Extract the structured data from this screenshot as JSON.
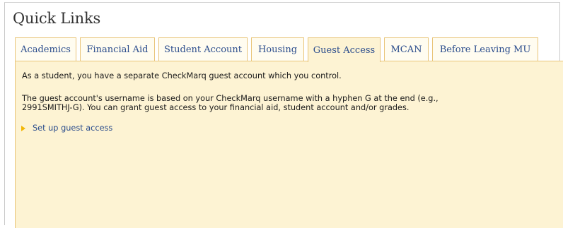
{
  "header": {
    "title": "Quick Links"
  },
  "tabs": [
    {
      "label": "Academics",
      "active": false
    },
    {
      "label": "Financial Aid",
      "active": false
    },
    {
      "label": "Student Account",
      "active": false
    },
    {
      "label": "Housing",
      "active": false
    },
    {
      "label": "Guest Access",
      "active": true
    },
    {
      "label": "MCAN",
      "active": false
    },
    {
      "label": "Before Leaving MU",
      "active": false
    }
  ],
  "panel": {
    "intro": "As a student, you have a separate CheckMarq guest account which you control.",
    "detail_line1": "The guest account's username is based on your CheckMarq username with a hyphen G at the end (e.g.,",
    "detail_line2": "2991SMITHJ-G). You can grant guest access to your financial aid, student account and/or grades.",
    "link_label": "Set up guest access"
  },
  "colors": {
    "tab_border": "#e9c57a",
    "panel_bg": "#fdf3d3",
    "link": "#2a4c8c",
    "arrow": "#f2b705"
  }
}
